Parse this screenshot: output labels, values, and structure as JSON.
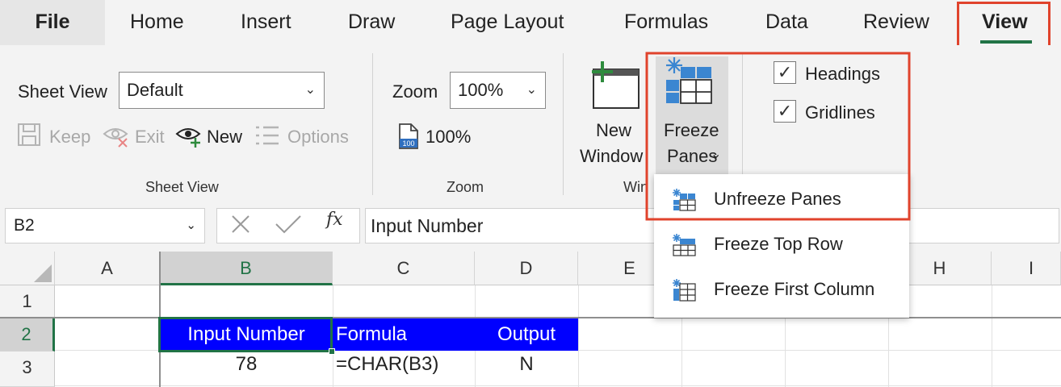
{
  "tabs": [
    "File",
    "Home",
    "Insert",
    "Draw",
    "Page Layout",
    "Formulas",
    "Data",
    "Review",
    "View"
  ],
  "ribbon": {
    "sheet_view": {
      "label": "Sheet View",
      "dropdown_value": "Default",
      "keep": "Keep",
      "exit": "Exit",
      "new": "New",
      "options": "Options",
      "group_label": "Sheet View"
    },
    "zoom": {
      "label": "Zoom",
      "dropdown_value": "100%",
      "hundred": "100%",
      "group_label": "Zoom"
    },
    "window": {
      "new_window_line1": "New",
      "new_window_line2": "Window",
      "freeze_line1": "Freeze",
      "freeze_line2": "Panes",
      "group_label": "Win"
    },
    "show": {
      "headings": "Headings",
      "gridlines": "Gridlines"
    }
  },
  "formula_bar": {
    "name_box": "B2",
    "fx": "fx",
    "value": "Input Number"
  },
  "freeze_menu": [
    "Unfreeze Panes",
    "Freeze Top Row",
    "Freeze First Column"
  ],
  "grid": {
    "columns": [
      "A",
      "B",
      "C",
      "D",
      "E",
      "H",
      "I"
    ],
    "rows": [
      "1",
      "2",
      "3"
    ],
    "header_row": [
      "Input Number",
      "Formula",
      "Output"
    ],
    "data_row": [
      "78",
      "=CHAR(B3)",
      "N"
    ]
  },
  "colors": {
    "accent": "#217346",
    "highlight": "#e0432c",
    "header_fill": "#0000ff",
    "freeze_icon": "#3b86d1"
  }
}
